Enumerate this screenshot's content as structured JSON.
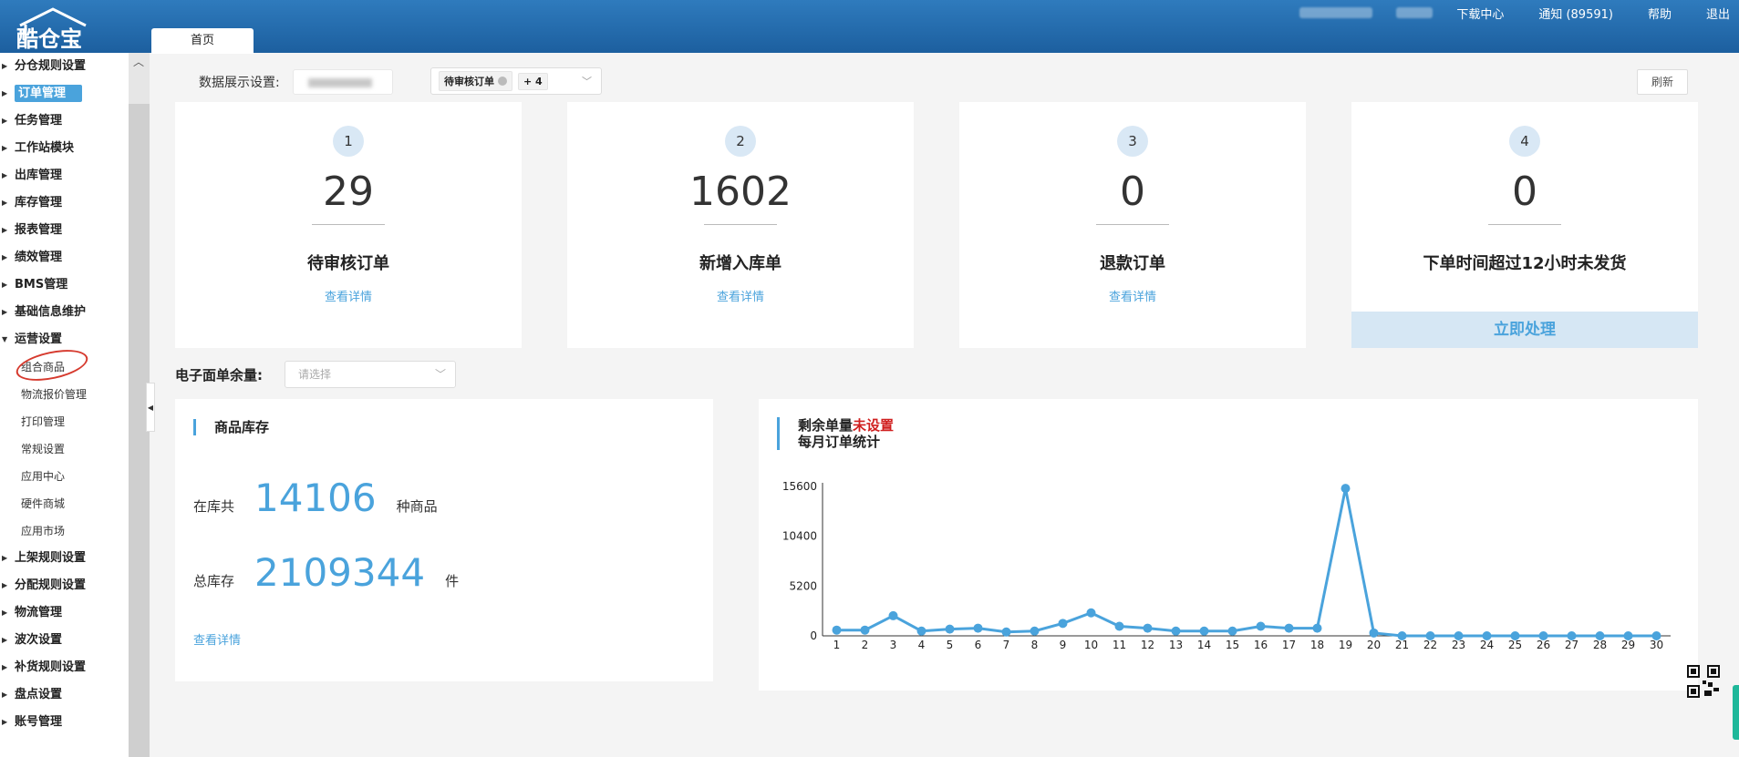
{
  "header": {
    "logo_text": "酷仓宝",
    "tab_home": "首页",
    "nav": {
      "download": "下载中心",
      "notice": "通知 (89591)",
      "help": "帮助",
      "logout": "退出"
    }
  },
  "sidebar": {
    "items": [
      {
        "label": "分仓规则设置"
      },
      {
        "label": "订单管理"
      },
      {
        "label": "任务管理"
      },
      {
        "label": "工作站模块"
      },
      {
        "label": "出库管理"
      },
      {
        "label": "库存管理"
      },
      {
        "label": "报表管理"
      },
      {
        "label": "绩效管理"
      },
      {
        "label": "BMS管理"
      },
      {
        "label": "基础信息维护"
      },
      {
        "label": "运营设置"
      }
    ],
    "sub_items": [
      {
        "label": "组合商品"
      },
      {
        "label": "物流报价管理"
      },
      {
        "label": "打印管理"
      },
      {
        "label": "常规设置"
      },
      {
        "label": "应用中心"
      },
      {
        "label": "硬件商城"
      },
      {
        "label": "应用市场"
      }
    ],
    "items_after": [
      {
        "label": "上架规则设置"
      },
      {
        "label": "分配规则设置"
      },
      {
        "label": "物流管理"
      },
      {
        "label": "波次设置"
      },
      {
        "label": "补货规则设置"
      },
      {
        "label": "盘点设置"
      },
      {
        "label": "账号管理"
      }
    ]
  },
  "toolbar": {
    "display_setting_label": "数据展示设置:",
    "tag_label": "待审核订单",
    "tag_more": "+ 4",
    "refresh": "刷新"
  },
  "stats": [
    {
      "index": "1",
      "value": "29",
      "label": "待审核订单",
      "link": "查看详情"
    },
    {
      "index": "2",
      "value": "1602",
      "label": "新增入库单",
      "link": "查看详情"
    },
    {
      "index": "3",
      "value": "0",
      "label": "退款订单",
      "link": "查看详情"
    },
    {
      "index": "4",
      "value": "0",
      "label": "下单时间超过12小时未发货",
      "action": "立即处理"
    }
  ],
  "ewaybill": {
    "label": "电子面单余量:",
    "placeholder": "请选择"
  },
  "inventory": {
    "title": "商品库存",
    "row1_prefix": "在库共",
    "row1_value": "14106",
    "row1_suffix": "种商品",
    "row2_prefix": "总库存",
    "row2_value": "2109344",
    "row2_suffix": "件",
    "link": "查看详情"
  },
  "order_stats": {
    "title_prefix": "剩余单量",
    "title_highlight": "未设置",
    "title_line2": "每月订单统计"
  },
  "colors": {
    "accent": "#4aa3dc",
    "header": "#2f7bbd",
    "highlight": "#d01f1f"
  },
  "chart_data": {
    "type": "line",
    "x": [
      1,
      2,
      3,
      4,
      5,
      6,
      7,
      8,
      9,
      10,
      11,
      12,
      13,
      14,
      15,
      16,
      17,
      18,
      19,
      20,
      21,
      22,
      23,
      24,
      25,
      26,
      27,
      28,
      29,
      30
    ],
    "series": [
      {
        "values": [
          600,
          600,
          2100,
          500,
          700,
          800,
          400,
          500,
          1300,
          2400,
          1000,
          800,
          500,
          500,
          500,
          1000,
          800,
          800,
          15400,
          300,
          0,
          0,
          0,
          0,
          0,
          0,
          0,
          0,
          0,
          0
        ]
      }
    ],
    "yticks": [
      0,
      5200,
      10400,
      15600
    ],
    "ylim": [
      0,
      15600
    ],
    "grid": false
  }
}
